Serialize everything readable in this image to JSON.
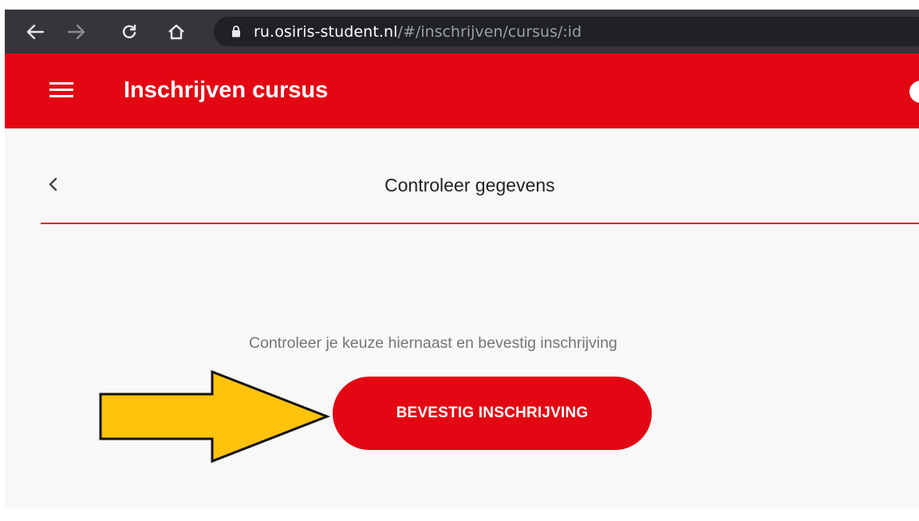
{
  "browser": {
    "url_host": "ru.osiris-student.nl",
    "url_path": "/#/inschrijven/cursus/:id",
    "icons": [
      "back-arrow-icon",
      "forward-arrow-icon",
      "reload-icon",
      "home-icon",
      "lock-icon"
    ]
  },
  "header": {
    "title": "Inschrijven cursus",
    "brand_color": "#e30613",
    "icons": [
      "hamburger-menu-icon"
    ]
  },
  "step": {
    "title": "Controleer gegevens",
    "back_icon": "chevron-left-icon"
  },
  "main": {
    "instruction": "Controleer je keuze hiernaast en bevestig inschrijving",
    "confirm_label": "BEVESTIG INSCHRIJVING"
  },
  "annotation": {
    "arrow_color": "#ffc30b",
    "icon": "pointer-arrow-icon"
  }
}
